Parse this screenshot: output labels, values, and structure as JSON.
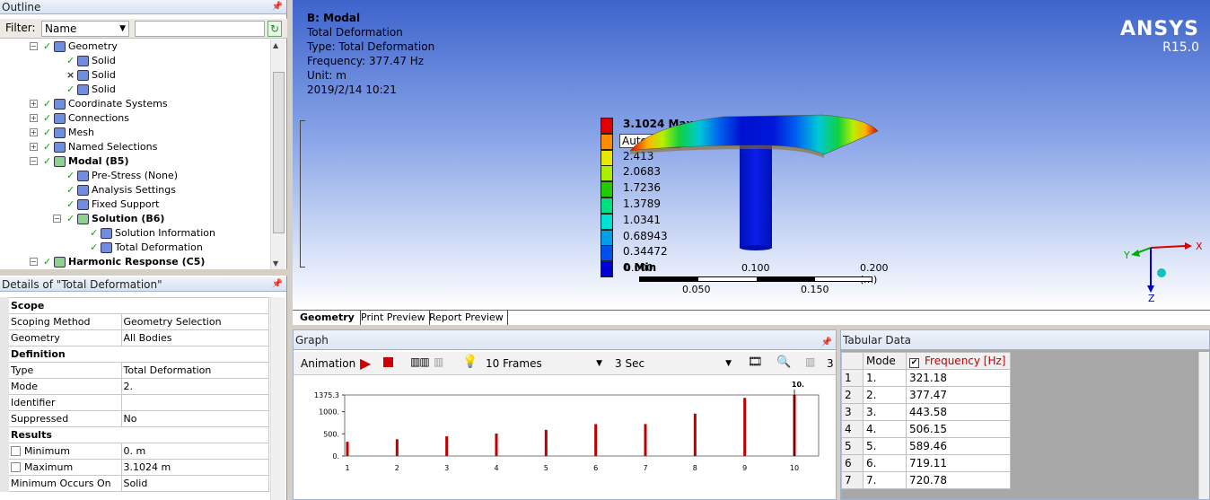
{
  "outline": {
    "title": "Outline",
    "filter_label": "Filter:",
    "filter_value": "Name",
    "items": [
      {
        "label": "Geometry",
        "indent": 1,
        "bold": false
      },
      {
        "label": "Solid",
        "indent": 2,
        "bold": false
      },
      {
        "label": "Solid",
        "indent": 2,
        "bold": false
      },
      {
        "label": "Solid",
        "indent": 2,
        "bold": false
      },
      {
        "label": "Coordinate Systems",
        "indent": 1,
        "bold": false
      },
      {
        "label": "Connections",
        "indent": 1,
        "bold": false
      },
      {
        "label": "Mesh",
        "indent": 1,
        "bold": false
      },
      {
        "label": "Named Selections",
        "indent": 1,
        "bold": false
      },
      {
        "label": "Modal (B5)",
        "indent": 1,
        "bold": true
      },
      {
        "label": "Pre-Stress (None)",
        "indent": 2,
        "bold": false
      },
      {
        "label": "Analysis Settings",
        "indent": 2,
        "bold": false
      },
      {
        "label": "Fixed Support",
        "indent": 2,
        "bold": false
      },
      {
        "label": "Solution (B6)",
        "indent": 2,
        "bold": true
      },
      {
        "label": "Solution Information",
        "indent": 3,
        "bold": false
      },
      {
        "label": "Total Deformation",
        "indent": 3,
        "bold": false
      },
      {
        "label": "Harmonic Response (C5)",
        "indent": 1,
        "bold": true
      }
    ]
  },
  "details": {
    "title": "Details of \"Total Deformation\"",
    "rows": [
      {
        "group": "Scope"
      },
      {
        "k": "Scoping Method",
        "v": "Geometry Selection"
      },
      {
        "k": "Geometry",
        "v": "All Bodies"
      },
      {
        "group": "Definition"
      },
      {
        "k": "Type",
        "v": "Total Deformation"
      },
      {
        "k": "Mode",
        "v": "2."
      },
      {
        "k": "Identifier",
        "v": ""
      },
      {
        "k": "Suppressed",
        "v": "No"
      },
      {
        "group": "Results"
      },
      {
        "k": "Minimum",
        "v": "0. m",
        "cb": true
      },
      {
        "k": "Maximum",
        "v": "3.1024 m",
        "cb": true
      },
      {
        "k": "Minimum Occurs On",
        "v": "Solid"
      }
    ]
  },
  "viewport": {
    "header": [
      "B: Modal",
      "Total Deformation",
      "Type: Total Deformation",
      "Frequency: 377.47 Hz",
      "Unit: m",
      "2019/2/14 10:21"
    ],
    "brand": "ANSYS",
    "version": "R15.0",
    "legend": [
      {
        "label": "3.1024 Max",
        "color": "#e00000"
      },
      {
        "label": "Automatic",
        "color": "#ff8c00"
      },
      {
        "label": "2.413",
        "color": "#e8e800"
      },
      {
        "label": "2.0683",
        "color": "#aaee00"
      },
      {
        "label": "1.7236",
        "color": "#22cc00"
      },
      {
        "label": "1.3789",
        "color": "#00e080"
      },
      {
        "label": "1.0341",
        "color": "#00e0d0"
      },
      {
        "label": "0.68943",
        "color": "#00a0e8"
      },
      {
        "label": "0.34472",
        "color": "#0050f0"
      },
      {
        "label": "0 Min",
        "color": "#0000d8"
      }
    ],
    "scale_top": [
      "0.000",
      "0.100",
      "0.200 (m)"
    ],
    "scale_bottom": [
      "0.050",
      "0.150"
    ],
    "tabs": [
      "Geometry",
      "Print Preview",
      "Report Preview"
    ]
  },
  "graph": {
    "title": "Graph",
    "animation_label": "Animation",
    "frames": "10 Frames",
    "duration": "3 Sec",
    "partial_label": "3"
  },
  "chart_data": {
    "type": "bar",
    "categories": [
      "1",
      "2",
      "3",
      "4",
      "5",
      "6",
      "7",
      "8",
      "9",
      "10"
    ],
    "values": [
      321.18,
      377.47,
      443.58,
      506.15,
      589.46,
      719.11,
      720.78,
      954.9,
      1310,
      1375.3
    ],
    "yticks": [
      "1375.3",
      "1000.",
      "500.",
      "0."
    ],
    "ylim": [
      0,
      1375.3
    ],
    "selected_label": "10.",
    "bar_color": "#c00000"
  },
  "tabular": {
    "title": "Tabular Data",
    "col_mode": "Mode",
    "col_freq": "Frequency [Hz]",
    "rows": [
      {
        "n": "1",
        "mode": "1.",
        "freq": "321.18"
      },
      {
        "n": "2",
        "mode": "2.",
        "freq": "377.47"
      },
      {
        "n": "3",
        "mode": "3.",
        "freq": "443.58"
      },
      {
        "n": "4",
        "mode": "4.",
        "freq": "506.15"
      },
      {
        "n": "5",
        "mode": "5.",
        "freq": "589.46"
      },
      {
        "n": "6",
        "mode": "6.",
        "freq": "719.11"
      },
      {
        "n": "7",
        "mode": "7.",
        "freq": "720.78"
      }
    ]
  }
}
